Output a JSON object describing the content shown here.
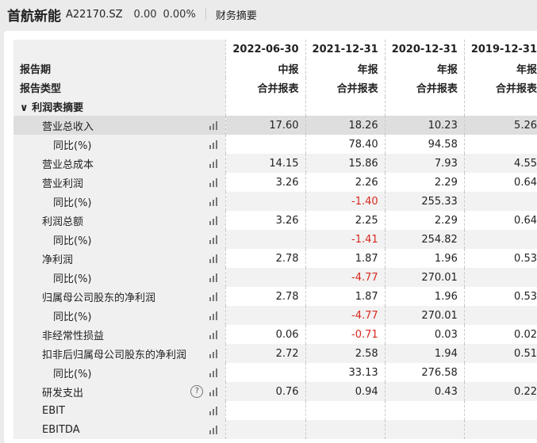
{
  "header": {
    "name": "首航新能",
    "code": "A22170.SZ",
    "price": "0.00",
    "change": "0.00%",
    "tab": "财务摘要"
  },
  "table": {
    "period_label": "报告期",
    "type_label": "报告类型",
    "section": "利润表摘要",
    "columns": [
      {
        "date": "2022-06-30",
        "period": "中报",
        "type": "合并报表"
      },
      {
        "date": "2021-12-31",
        "period": "年报",
        "type": "合并报表"
      },
      {
        "date": "2020-12-31",
        "period": "年报",
        "type": "合并报表"
      },
      {
        "date": "2019-12-31",
        "period": "年报",
        "type": "合并报表"
      }
    ],
    "rows": [
      {
        "label": "营业总收入",
        "sub": false,
        "values": [
          "17.60",
          "18.26",
          "10.23",
          "5.26"
        ]
      },
      {
        "label": "同比(%)",
        "sub": true,
        "values": [
          "",
          "78.40",
          "94.58",
          ""
        ]
      },
      {
        "label": "营业总成本",
        "sub": false,
        "values": [
          "14.15",
          "15.86",
          "7.93",
          "4.55"
        ]
      },
      {
        "label": "营业利润",
        "sub": false,
        "values": [
          "3.26",
          "2.26",
          "2.29",
          "0.64"
        ]
      },
      {
        "label": "同比(%)",
        "sub": true,
        "values": [
          "",
          "-1.40",
          "255.33",
          ""
        ]
      },
      {
        "label": "利润总额",
        "sub": false,
        "values": [
          "3.26",
          "2.25",
          "2.29",
          "0.64"
        ]
      },
      {
        "label": "同比(%)",
        "sub": true,
        "values": [
          "",
          "-1.41",
          "254.82",
          ""
        ]
      },
      {
        "label": "净利润",
        "sub": false,
        "values": [
          "2.78",
          "1.87",
          "1.96",
          "0.53"
        ]
      },
      {
        "label": "同比(%)",
        "sub": true,
        "values": [
          "",
          "-4.77",
          "270.01",
          ""
        ]
      },
      {
        "label": "归属母公司股东的净利润",
        "sub": false,
        "values": [
          "2.78",
          "1.87",
          "1.96",
          "0.53"
        ]
      },
      {
        "label": "同比(%)",
        "sub": true,
        "values": [
          "",
          "-4.77",
          "270.01",
          ""
        ]
      },
      {
        "label": "非经常性损益",
        "sub": false,
        "values": [
          "0.06",
          "-0.71",
          "0.03",
          "0.02"
        ]
      },
      {
        "label": "扣非后归属母公司股东的净利润",
        "sub": false,
        "values": [
          "2.72",
          "2.58",
          "1.94",
          "0.51"
        ]
      },
      {
        "label": "同比(%)",
        "sub": true,
        "values": [
          "",
          "33.13",
          "276.58",
          ""
        ]
      },
      {
        "label": "研发支出",
        "sub": false,
        "help": "?",
        "values": [
          "0.76",
          "0.94",
          "0.43",
          "0.22"
        ]
      },
      {
        "label": "EBIT",
        "sub": false,
        "values": [
          "",
          "",
          "",
          ""
        ]
      },
      {
        "label": "EBITDA",
        "sub": false,
        "values": [
          "",
          "",
          "",
          ""
        ]
      }
    ]
  },
  "colors": {
    "negative": "#d9281f",
    "hover_row": "#dedede"
  }
}
